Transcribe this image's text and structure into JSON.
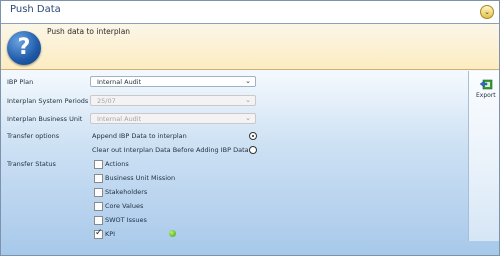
{
  "window": {
    "title": "Push Data",
    "collapse_icon": "chevron-down-icon"
  },
  "banner": {
    "text": "Push data to interplan",
    "icon": "help-icon"
  },
  "form": {
    "ibp_plan": {
      "label": "IBP Plan",
      "value": "Internal Audit"
    },
    "system_periods": {
      "label": "Interplan System Periods",
      "value": "25/07"
    },
    "business_unit": {
      "label": "Interplan Business Unit",
      "value": "Internal Audit"
    },
    "transfer_options": {
      "label": "Transfer options",
      "options": [
        {
          "label": "Append IBP Data to interplan",
          "selected": true
        },
        {
          "label": "Clear out Interplan Data Before Adding IBP Data",
          "selected": false
        }
      ]
    },
    "transfer_status": {
      "label": "Transfer Status",
      "items": [
        {
          "label": "Actions",
          "checked": false
        },
        {
          "label": "Business Unit Mission",
          "checked": false
        },
        {
          "label": "Stakeholders",
          "checked": false
        },
        {
          "label": "Core Values",
          "checked": false
        },
        {
          "label": "SWOT Issues",
          "checked": false
        },
        {
          "label": "KPI",
          "checked": true,
          "status_icon": "success-check-icon"
        }
      ]
    }
  },
  "toolbar": {
    "export_label": "Export",
    "export_icon": "export-icon"
  }
}
